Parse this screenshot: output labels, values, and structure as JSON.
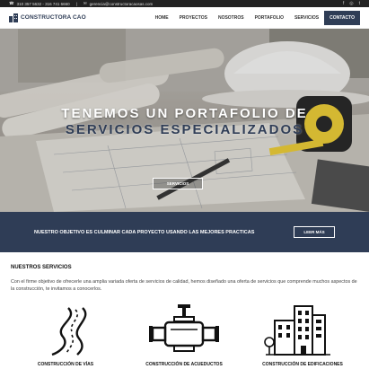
{
  "topbar": {
    "phone": "310 357 5632 - 316 741 6660",
    "email": "gerencia@constructoracaosas.com",
    "social": [
      "facebook-icon",
      "instagram-icon",
      "twitter-icon"
    ]
  },
  "header": {
    "logo_text": "CONSTRUCTORA CAO",
    "nav": [
      {
        "label": "HOME",
        "active": false
      },
      {
        "label": "PROYECTOS",
        "active": false
      },
      {
        "label": "NOSOTROS",
        "active": false
      },
      {
        "label": "PORTAFOLIO",
        "active": false
      },
      {
        "label": "SERVICIOS",
        "active": false
      },
      {
        "label": "CONTACTO",
        "active": true
      }
    ]
  },
  "hero": {
    "title_line1": "TENEMOS UN PORTAFOLIO DE",
    "title_line2": "SERVICIOS ESPECIALIZADOS",
    "button_label": "SERVICIOS"
  },
  "banner": {
    "text": "NUESTRO OBJETIVO ES CULMINAR CADA PROYECTO USANDO LAS MEJORES PRACTICAS",
    "button_label": "LEER MÁS"
  },
  "services": {
    "heading": "NUESTROS SERVICIOS",
    "description": "Con el firme objetivo de ofrecerle una amplia variada oferta de servicios de calidad, hemos diseñado una oferta de servicios que comprende muchos aspectos de la construcción, te invitamos a conocerlos.",
    "items": [
      {
        "label": "CONSTRUCCIÓN DE VÍAS",
        "icon": "road-icon"
      },
      {
        "label": "CONSTRUCCIÓN DE ACUEDUCTOS",
        "icon": "pipe-valve-icon"
      },
      {
        "label": "CONSTRUCCIÓN DE EDIFICACIONES",
        "icon": "buildings-icon"
      }
    ]
  },
  "colors": {
    "brand_navy": "#2f3d56",
    "topbar": "#222222"
  }
}
